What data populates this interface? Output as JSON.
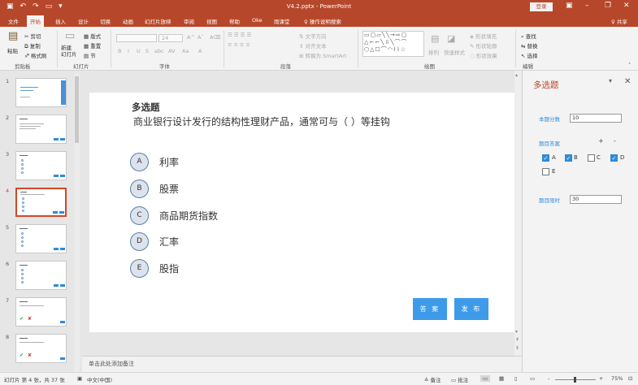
{
  "app": {
    "window_title": "V4.2.pptx - PowerPoint",
    "login_button": "登录",
    "share_label": "♀ 共享",
    "qat_icons": [
      "save-icon",
      "undo-icon",
      "redo-icon",
      "start-slideshow-icon",
      "customize-qat-icon"
    ]
  },
  "menu": {
    "tabs": [
      "文件",
      "开始",
      "插入",
      "设计",
      "切换",
      "动画",
      "幻灯片放映",
      "审阅",
      "视图",
      "帮助",
      "Oke",
      "雨课堂",
      "操作说明搜索"
    ],
    "active": "开始"
  },
  "ribbon": {
    "clipboard": {
      "paste": "粘贴",
      "cut": "剪切",
      "copy": "复制",
      "format_painter": "格式刷",
      "label": "剪贴板"
    },
    "slides": {
      "new_slide": "新建\n幻灯片",
      "layout": "版式",
      "reset": "重置",
      "section": "节",
      "label": "幻灯片"
    },
    "font": {
      "size": "24",
      "label": "字体",
      "tools": [
        "B",
        "I",
        "U",
        "S",
        "abc",
        "AV",
        "Aa",
        "A"
      ]
    },
    "paragraph": {
      "text_direction": "文字方向",
      "align_text": "对齐文本",
      "smartart": "转换为 SmartArt",
      "label": "段落"
    },
    "drawing": {
      "arrange": "排列",
      "quick_styles": "快速样式",
      "fill": "形状填充",
      "outline": "形状轮廓",
      "effects": "形状效果",
      "label": "绘图"
    },
    "editing": {
      "find": "查找",
      "replace": "替换",
      "select": "选择",
      "label": "编辑"
    }
  },
  "thumbnails": {
    "numbers": [
      "1",
      "2",
      "3",
      "4",
      "5",
      "6",
      "7",
      "8"
    ],
    "selected": "4"
  },
  "slide": {
    "title": "多选题",
    "question": "商业银行设计发行的结构性理财产品，通常可与（    ）等挂钩",
    "options": [
      {
        "letter": "A",
        "text": "利率"
      },
      {
        "letter": "B",
        "text": "股票"
      },
      {
        "letter": "C",
        "text": "商品期货指数"
      },
      {
        "letter": "D",
        "text": "汇率"
      },
      {
        "letter": "E",
        "text": "股指"
      }
    ],
    "answer_button": "答 案",
    "publish_button": "发 布"
  },
  "notes": {
    "placeholder": "单击此处添加备注"
  },
  "pane": {
    "title": "多选题",
    "score_label": "本题分数",
    "score_value": "10",
    "answer_label": "题目答案",
    "add_sign": "+",
    "remove_sign": "-",
    "answers": [
      {
        "letter": "A",
        "checked": true
      },
      {
        "letter": "B",
        "checked": true
      },
      {
        "letter": "C",
        "checked": false
      },
      {
        "letter": "D",
        "checked": true
      },
      {
        "letter": "E",
        "checked": false
      }
    ],
    "time_label": "题目限时",
    "time_value": "30"
  },
  "status": {
    "slide_info": "幻灯片 第 4 张，共 37 张",
    "language": "中文(中国)",
    "notes_btn": "备注",
    "comments_btn": "批注",
    "zoom": "75%",
    "zoom_minus": "-",
    "zoom_plus": "+"
  },
  "colors": {
    "accent": "#b7472a",
    "button_blue": "#3d9be9",
    "pane_label": "#2e8bd8"
  }
}
